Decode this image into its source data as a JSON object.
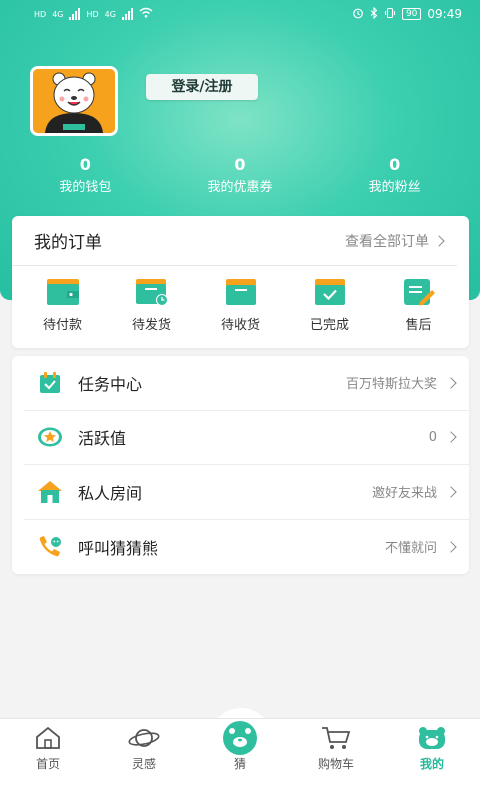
{
  "status_bar": {
    "left_hd1": "HD",
    "left_net1": "4G",
    "left_hd2": "HD",
    "left_net2": "4G",
    "battery": "90",
    "time": "09:49"
  },
  "profile": {
    "login_label": "登录/注册"
  },
  "stats": [
    {
      "value": "0",
      "label": "我的钱包"
    },
    {
      "value": "0",
      "label": "我的优惠券"
    },
    {
      "value": "0",
      "label": "我的粉丝"
    }
  ],
  "orders": {
    "title": "我的订单",
    "view_all": "查看全部订单",
    "items": [
      {
        "label": "待付款",
        "icon": "wallet-icon"
      },
      {
        "label": "待发货",
        "icon": "pending-shipment-icon"
      },
      {
        "label": "待收货",
        "icon": "package-icon"
      },
      {
        "label": "已完成",
        "icon": "completed-box-icon"
      },
      {
        "label": "售后",
        "icon": "after-sales-icon"
      }
    ]
  },
  "menu": [
    {
      "label": "任务中心",
      "value": "百万特斯拉大奖",
      "icon": "task-calendar-icon"
    },
    {
      "label": "活跃值",
      "value": "0",
      "icon": "star-badge-icon"
    },
    {
      "label": "私人房间",
      "value": "邀好友来战",
      "icon": "house-icon"
    },
    {
      "label": "呼叫猜猜熊",
      "value": "不懂就问",
      "icon": "phone-call-icon"
    }
  ],
  "tabbar": [
    {
      "label": "首页",
      "icon": "home-icon"
    },
    {
      "label": "灵感",
      "icon": "planet-icon"
    },
    {
      "label": "猜",
      "icon": "bear-guess-icon"
    },
    {
      "label": "购物车",
      "icon": "cart-icon"
    },
    {
      "label": "我的",
      "icon": "bear-profile-icon",
      "active": true
    }
  ],
  "colors": {
    "brand": "#27bfa1",
    "accent": "#26b89b",
    "orange": "#f6a21c"
  }
}
